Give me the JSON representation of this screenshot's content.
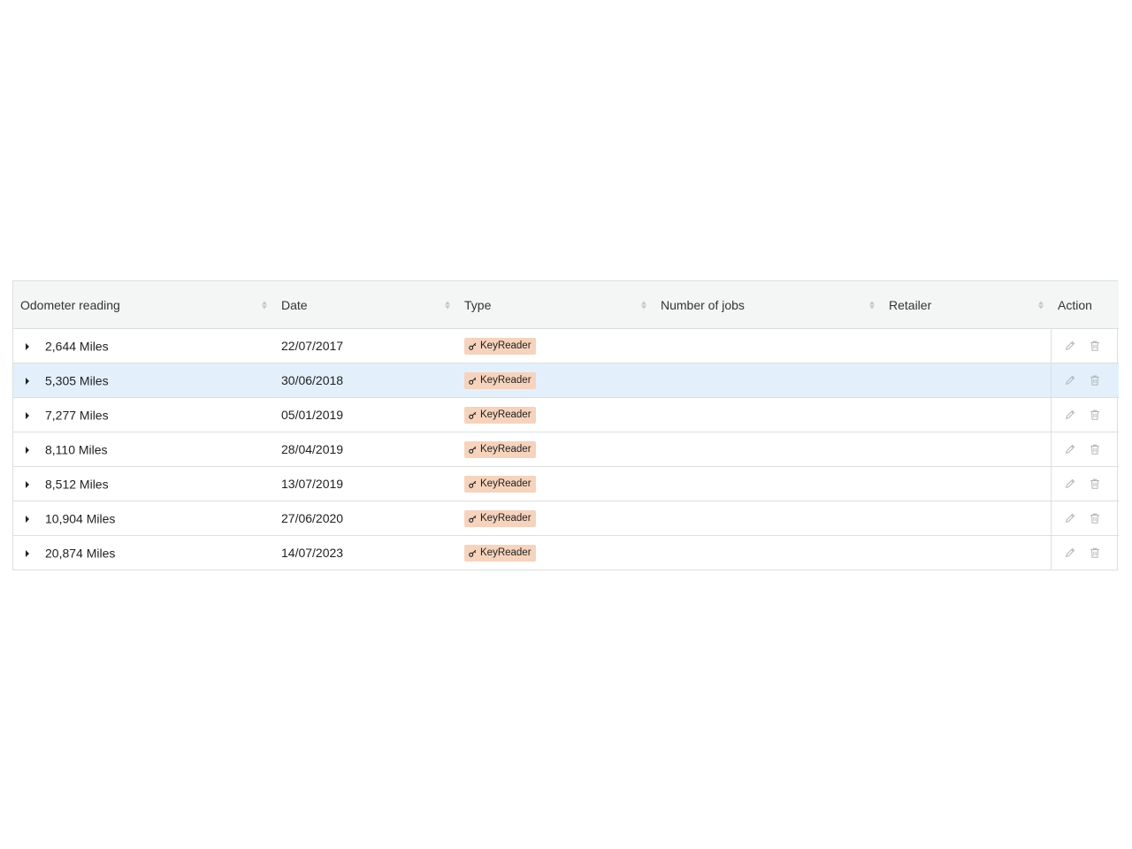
{
  "table": {
    "columns": [
      {
        "label": "Odometer reading",
        "sortable": true
      },
      {
        "label": "Date",
        "sortable": true
      },
      {
        "label": "Type",
        "sortable": true
      },
      {
        "label": "Number of jobs",
        "sortable": true
      },
      {
        "label": "Retailer",
        "sortable": true
      },
      {
        "label": "Action",
        "sortable": false
      }
    ],
    "rows": [
      {
        "odometer": "2,644 Miles",
        "date": "22/07/2017",
        "type": "KeyReader",
        "jobs": "",
        "retailer": "",
        "selected": false
      },
      {
        "odometer": "5,305 Miles",
        "date": "30/06/2018",
        "type": "KeyReader",
        "jobs": "",
        "retailer": "",
        "selected": true
      },
      {
        "odometer": "7,277 Miles",
        "date": "05/01/2019",
        "type": "KeyReader",
        "jobs": "",
        "retailer": "",
        "selected": false
      },
      {
        "odometer": "8,110 Miles",
        "date": "28/04/2019",
        "type": "KeyReader",
        "jobs": "",
        "retailer": "",
        "selected": false
      },
      {
        "odometer": "8,512 Miles",
        "date": "13/07/2019",
        "type": "KeyReader",
        "jobs": "",
        "retailer": "",
        "selected": false
      },
      {
        "odometer": "10,904 Miles",
        "date": "27/06/2020",
        "type": "KeyReader",
        "jobs": "",
        "retailer": "",
        "selected": false
      },
      {
        "odometer": "20,874 Miles",
        "date": "14/07/2023",
        "type": "KeyReader",
        "jobs": "",
        "retailer": "",
        "selected": false
      }
    ],
    "type_badge_color": "#f6d3bd",
    "selected_row_color": "#e3f0fc",
    "icons": {
      "type": "key-icon",
      "expand": "caret-right-icon",
      "edit": "pencil-icon",
      "delete": "trash-icon",
      "sort": "sort-icon"
    }
  }
}
